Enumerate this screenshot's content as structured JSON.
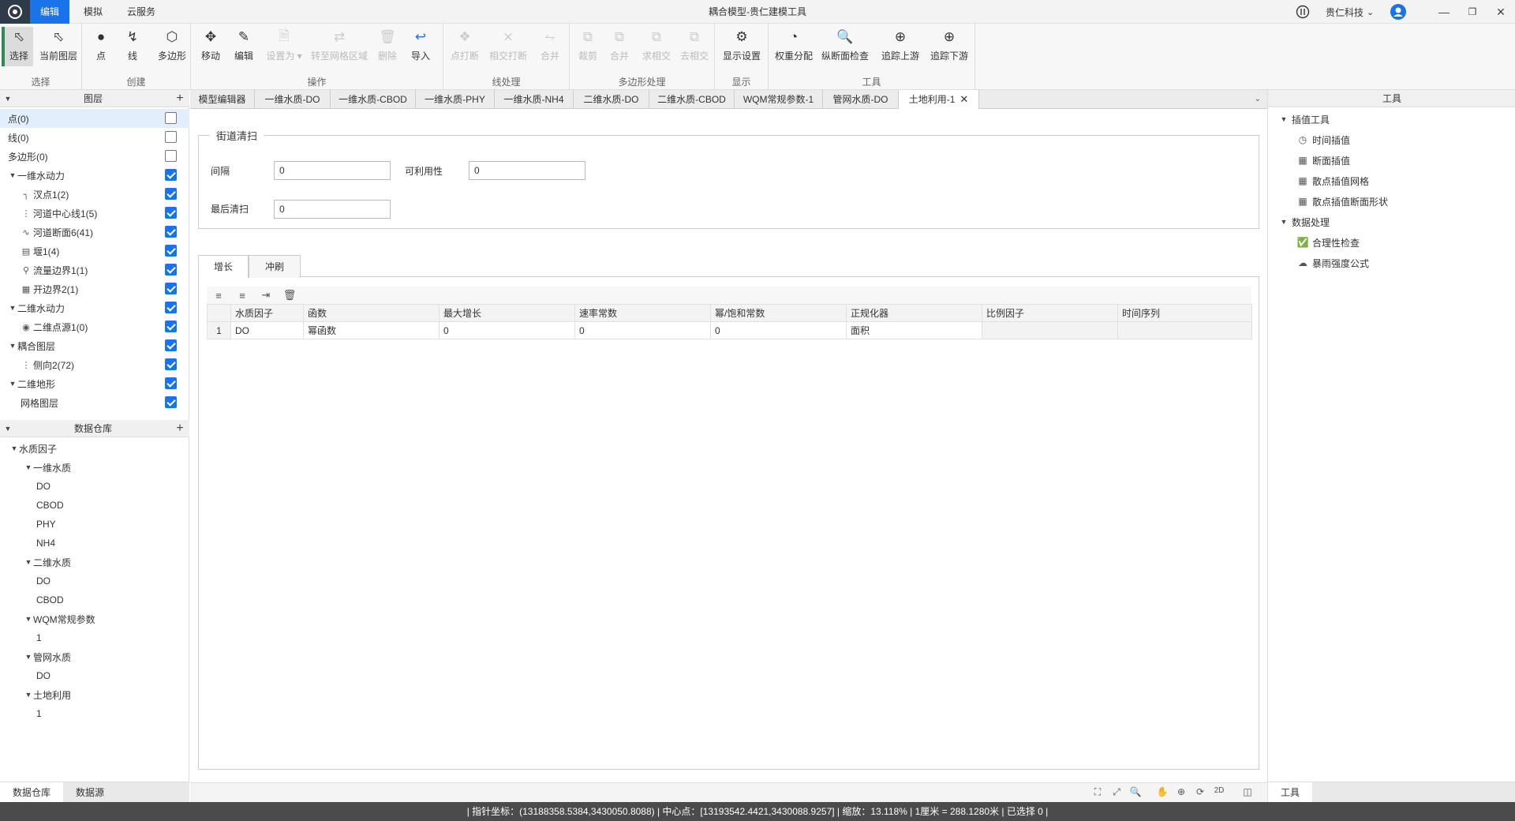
{
  "titlebar": {
    "menu_tabs": [
      "编辑",
      "模拟",
      "云服务"
    ],
    "window_title": "耦合模型-贵仁建模工具",
    "company": "贵仁科技",
    "company_caret": "⌄"
  },
  "ribbon": {
    "groups": {
      "select": "选择",
      "create": "创建",
      "operate": "操作",
      "line_proc": "线处理",
      "poly_proc": "多边形处理",
      "display": "显示",
      "tools": "工具"
    },
    "buttons": {
      "select": "选择",
      "current_layer": "当前图层",
      "point": "点",
      "line": "线",
      "polygon": "多边形",
      "move": "移动",
      "edit": "编辑",
      "set_as": "设置为",
      "to_mesh": "转至网格区域",
      "delete": "删除",
      "import": "导入",
      "point_break": "点打断",
      "intersect_break": "相交打断",
      "merge_line": "合并",
      "clip": "裁剪",
      "merge_poly": "合并",
      "intersect": "求相交",
      "remove_intersect": "去相交",
      "display_settings": "显示设置",
      "weight_dist": "权重分配",
      "section_check": "纵断面检查",
      "trace_up": "追踪上游",
      "trace_down": "追踪下游"
    }
  },
  "layers": {
    "header": "图层",
    "rows": [
      {
        "label": "点(0)",
        "checked": false
      },
      {
        "label": "线(0)",
        "checked": false
      },
      {
        "label": "多边形(0)",
        "checked": false
      },
      {
        "label": "一维水动力",
        "checked": true
      },
      {
        "label": "汊点1(2)",
        "checked": true
      },
      {
        "label": "河道中心线1(5)",
        "checked": true
      },
      {
        "label": "河道断面6(41)",
        "checked": true
      },
      {
        "label": "堰1(4)",
        "checked": true
      },
      {
        "label": "流量边界1(1)",
        "checked": true
      },
      {
        "label": "开边界2(1)",
        "checked": true
      },
      {
        "label": "二维水动力",
        "checked": true
      },
      {
        "label": "二维点源1(0)",
        "checked": true
      },
      {
        "label": "耦合图层",
        "checked": true
      },
      {
        "label": "侧向2(72)",
        "checked": true
      },
      {
        "label": "二维地形",
        "checked": true
      },
      {
        "label": "网格图层",
        "checked": true
      }
    ]
  },
  "warehouse": {
    "header": "数据仓库",
    "items": [
      "水质因子",
      "一维水质",
      "DO",
      "CBOD",
      "PHY",
      "NH4",
      "二维水质",
      "DO",
      "CBOD",
      "WQM常规参数",
      "1",
      "管网水质",
      "DO",
      "土地利用",
      "1"
    ],
    "tabs": [
      "数据仓库",
      "数据源"
    ]
  },
  "doc_tabs": [
    "模型编辑器",
    "一维水质-DO",
    "一维水质-CBOD",
    "一维水质-PHY",
    "一维水质-NH4",
    "二维水质-DO",
    "二维水质-CBOD",
    "WQM常规参数-1",
    "管网水质-DO",
    "土地利用-1"
  ],
  "form": {
    "legend": "街道清扫",
    "interval_label": "间隔",
    "interval_value": "0",
    "availability_label": "可利用性",
    "availability_value": "0",
    "last_sweep_label": "最后清扫",
    "last_sweep_value": "0"
  },
  "sub_tabs": [
    "增长",
    "冲刷"
  ],
  "grid": {
    "columns": [
      "",
      "水质因子",
      "函数",
      "最大增长",
      "速率常数",
      "幂/饱和常数",
      "正规化器",
      "比例因子",
      "时间序列"
    ],
    "rows": [
      [
        "1",
        "DO",
        "幂函数",
        "0",
        "0",
        "0",
        "面积",
        "",
        ""
      ]
    ]
  },
  "tools_panel": {
    "header": "工具",
    "groups": [
      {
        "label": "插值工具",
        "items": [
          "时间插值",
          "断面插值",
          "散点插值网格",
          "散点插值断面形状"
        ]
      },
      {
        "label": "数据处理",
        "items": [
          "合理性检查",
          "暴雨强度公式"
        ]
      }
    ],
    "bottom_tab": "工具"
  },
  "map_tools": {
    "mode_2d": "2D"
  },
  "status": {
    "text": "|  指针坐标：(13188358.5384,3430050.8088)   |  中心点：[13193542.4421,3430088.9257]   |  缩放：13.118%   |  1厘米 = 288.1280米   |  已选择 0   |"
  }
}
